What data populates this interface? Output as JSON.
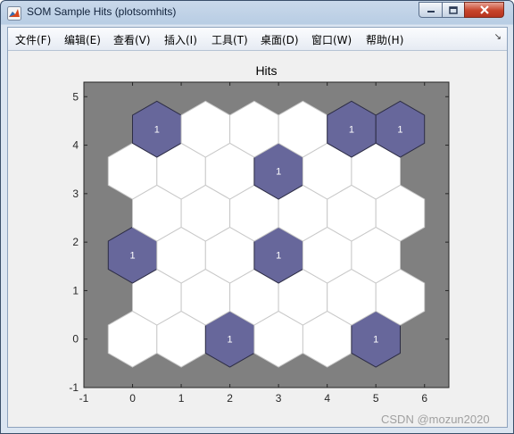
{
  "window": {
    "title": "SOM Sample Hits (plotsomhits)",
    "icon": "matlab-figure-icon"
  },
  "menubar": {
    "items": [
      "文件(F)",
      "编辑(E)",
      "查看(V)",
      "插入(I)",
      "工具(T)",
      "桌面(D)",
      "窗口(W)",
      "帮助(H)"
    ],
    "overflow_arrow": "↘"
  },
  "chart_data": {
    "type": "heatmap",
    "title": "Hits",
    "xlabel": "",
    "ylabel": "",
    "xlim": [
      -1,
      6.5
    ],
    "ylim": [
      -1,
      5.3
    ],
    "xticks": [
      -1,
      0,
      1,
      2,
      3,
      4,
      5,
      6
    ],
    "yticks": [
      -1,
      0,
      1,
      2,
      3,
      4,
      5
    ],
    "grid": false,
    "background_color": "#808080",
    "empty_color": "#ffffff",
    "hit_color": "#67679b",
    "hexagons": [
      {
        "x": 0,
        "y": 0,
        "hits": 0
      },
      {
        "x": 1,
        "y": 0,
        "hits": 0
      },
      {
        "x": 2,
        "y": 0,
        "hits": 1
      },
      {
        "x": 3,
        "y": 0,
        "hits": 0
      },
      {
        "x": 4,
        "y": 0,
        "hits": 0
      },
      {
        "x": 5,
        "y": 0,
        "hits": 1
      },
      {
        "x": 0.5,
        "y": 0.866,
        "hits": 0
      },
      {
        "x": 1.5,
        "y": 0.866,
        "hits": 0
      },
      {
        "x": 2.5,
        "y": 0.866,
        "hits": 0
      },
      {
        "x": 3.5,
        "y": 0.866,
        "hits": 0
      },
      {
        "x": 4.5,
        "y": 0.866,
        "hits": 0
      },
      {
        "x": 5.5,
        "y": 0.866,
        "hits": 0
      },
      {
        "x": 0,
        "y": 1.732,
        "hits": 1
      },
      {
        "x": 1,
        "y": 1.732,
        "hits": 0
      },
      {
        "x": 2,
        "y": 1.732,
        "hits": 0
      },
      {
        "x": 3,
        "y": 1.732,
        "hits": 1
      },
      {
        "x": 4,
        "y": 1.732,
        "hits": 0
      },
      {
        "x": 5,
        "y": 1.732,
        "hits": 0
      },
      {
        "x": 0.5,
        "y": 2.598,
        "hits": 0
      },
      {
        "x": 1.5,
        "y": 2.598,
        "hits": 0
      },
      {
        "x": 2.5,
        "y": 2.598,
        "hits": 0
      },
      {
        "x": 3.5,
        "y": 2.598,
        "hits": 0
      },
      {
        "x": 4.5,
        "y": 2.598,
        "hits": 0
      },
      {
        "x": 5.5,
        "y": 2.598,
        "hits": 0
      },
      {
        "x": 0,
        "y": 3.464,
        "hits": 0
      },
      {
        "x": 1,
        "y": 3.464,
        "hits": 0
      },
      {
        "x": 2,
        "y": 3.464,
        "hits": 0
      },
      {
        "x": 3,
        "y": 3.464,
        "hits": 1
      },
      {
        "x": 4,
        "y": 3.464,
        "hits": 0
      },
      {
        "x": 5,
        "y": 3.464,
        "hits": 0
      },
      {
        "x": 0.5,
        "y": 4.33,
        "hits": 1
      },
      {
        "x": 1.5,
        "y": 4.33,
        "hits": 0
      },
      {
        "x": 2.5,
        "y": 4.33,
        "hits": 0
      },
      {
        "x": 3.5,
        "y": 4.33,
        "hits": 0
      },
      {
        "x": 4.5,
        "y": 4.33,
        "hits": 1
      },
      {
        "x": 5.5,
        "y": 4.33,
        "hits": 1
      }
    ]
  },
  "watermark": "CSDN @mozun2020"
}
